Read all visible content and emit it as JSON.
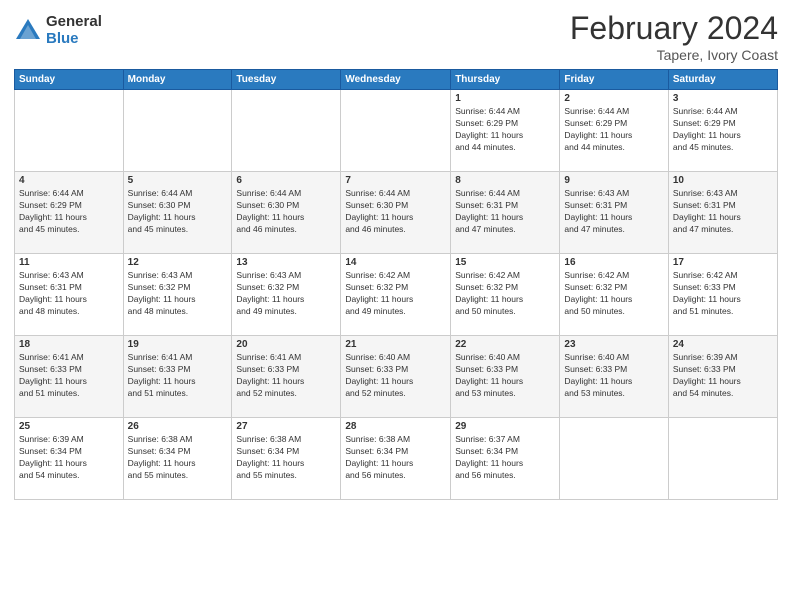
{
  "logo": {
    "general": "General",
    "blue": "Blue"
  },
  "header": {
    "month": "February 2024",
    "location": "Tapere, Ivory Coast"
  },
  "weekdays": [
    "Sunday",
    "Monday",
    "Tuesday",
    "Wednesday",
    "Thursday",
    "Friday",
    "Saturday"
  ],
  "weeks": [
    [
      {
        "day": "",
        "info": ""
      },
      {
        "day": "",
        "info": ""
      },
      {
        "day": "",
        "info": ""
      },
      {
        "day": "",
        "info": ""
      },
      {
        "day": "1",
        "info": "Sunrise: 6:44 AM\nSunset: 6:29 PM\nDaylight: 11 hours\nand 44 minutes."
      },
      {
        "day": "2",
        "info": "Sunrise: 6:44 AM\nSunset: 6:29 PM\nDaylight: 11 hours\nand 44 minutes."
      },
      {
        "day": "3",
        "info": "Sunrise: 6:44 AM\nSunset: 6:29 PM\nDaylight: 11 hours\nand 45 minutes."
      }
    ],
    [
      {
        "day": "4",
        "info": "Sunrise: 6:44 AM\nSunset: 6:29 PM\nDaylight: 11 hours\nand 45 minutes."
      },
      {
        "day": "5",
        "info": "Sunrise: 6:44 AM\nSunset: 6:30 PM\nDaylight: 11 hours\nand 45 minutes."
      },
      {
        "day": "6",
        "info": "Sunrise: 6:44 AM\nSunset: 6:30 PM\nDaylight: 11 hours\nand 46 minutes."
      },
      {
        "day": "7",
        "info": "Sunrise: 6:44 AM\nSunset: 6:30 PM\nDaylight: 11 hours\nand 46 minutes."
      },
      {
        "day": "8",
        "info": "Sunrise: 6:44 AM\nSunset: 6:31 PM\nDaylight: 11 hours\nand 47 minutes."
      },
      {
        "day": "9",
        "info": "Sunrise: 6:43 AM\nSunset: 6:31 PM\nDaylight: 11 hours\nand 47 minutes."
      },
      {
        "day": "10",
        "info": "Sunrise: 6:43 AM\nSunset: 6:31 PM\nDaylight: 11 hours\nand 47 minutes."
      }
    ],
    [
      {
        "day": "11",
        "info": "Sunrise: 6:43 AM\nSunset: 6:31 PM\nDaylight: 11 hours\nand 48 minutes."
      },
      {
        "day": "12",
        "info": "Sunrise: 6:43 AM\nSunset: 6:32 PM\nDaylight: 11 hours\nand 48 minutes."
      },
      {
        "day": "13",
        "info": "Sunrise: 6:43 AM\nSunset: 6:32 PM\nDaylight: 11 hours\nand 49 minutes."
      },
      {
        "day": "14",
        "info": "Sunrise: 6:42 AM\nSunset: 6:32 PM\nDaylight: 11 hours\nand 49 minutes."
      },
      {
        "day": "15",
        "info": "Sunrise: 6:42 AM\nSunset: 6:32 PM\nDaylight: 11 hours\nand 50 minutes."
      },
      {
        "day": "16",
        "info": "Sunrise: 6:42 AM\nSunset: 6:32 PM\nDaylight: 11 hours\nand 50 minutes."
      },
      {
        "day": "17",
        "info": "Sunrise: 6:42 AM\nSunset: 6:33 PM\nDaylight: 11 hours\nand 51 minutes."
      }
    ],
    [
      {
        "day": "18",
        "info": "Sunrise: 6:41 AM\nSunset: 6:33 PM\nDaylight: 11 hours\nand 51 minutes."
      },
      {
        "day": "19",
        "info": "Sunrise: 6:41 AM\nSunset: 6:33 PM\nDaylight: 11 hours\nand 51 minutes."
      },
      {
        "day": "20",
        "info": "Sunrise: 6:41 AM\nSunset: 6:33 PM\nDaylight: 11 hours\nand 52 minutes."
      },
      {
        "day": "21",
        "info": "Sunrise: 6:40 AM\nSunset: 6:33 PM\nDaylight: 11 hours\nand 52 minutes."
      },
      {
        "day": "22",
        "info": "Sunrise: 6:40 AM\nSunset: 6:33 PM\nDaylight: 11 hours\nand 53 minutes."
      },
      {
        "day": "23",
        "info": "Sunrise: 6:40 AM\nSunset: 6:33 PM\nDaylight: 11 hours\nand 53 minutes."
      },
      {
        "day": "24",
        "info": "Sunrise: 6:39 AM\nSunset: 6:33 PM\nDaylight: 11 hours\nand 54 minutes."
      }
    ],
    [
      {
        "day": "25",
        "info": "Sunrise: 6:39 AM\nSunset: 6:34 PM\nDaylight: 11 hours\nand 54 minutes."
      },
      {
        "day": "26",
        "info": "Sunrise: 6:38 AM\nSunset: 6:34 PM\nDaylight: 11 hours\nand 55 minutes."
      },
      {
        "day": "27",
        "info": "Sunrise: 6:38 AM\nSunset: 6:34 PM\nDaylight: 11 hours\nand 55 minutes."
      },
      {
        "day": "28",
        "info": "Sunrise: 6:38 AM\nSunset: 6:34 PM\nDaylight: 11 hours\nand 56 minutes."
      },
      {
        "day": "29",
        "info": "Sunrise: 6:37 AM\nSunset: 6:34 PM\nDaylight: 11 hours\nand 56 minutes."
      },
      {
        "day": "",
        "info": ""
      },
      {
        "day": "",
        "info": ""
      }
    ]
  ]
}
